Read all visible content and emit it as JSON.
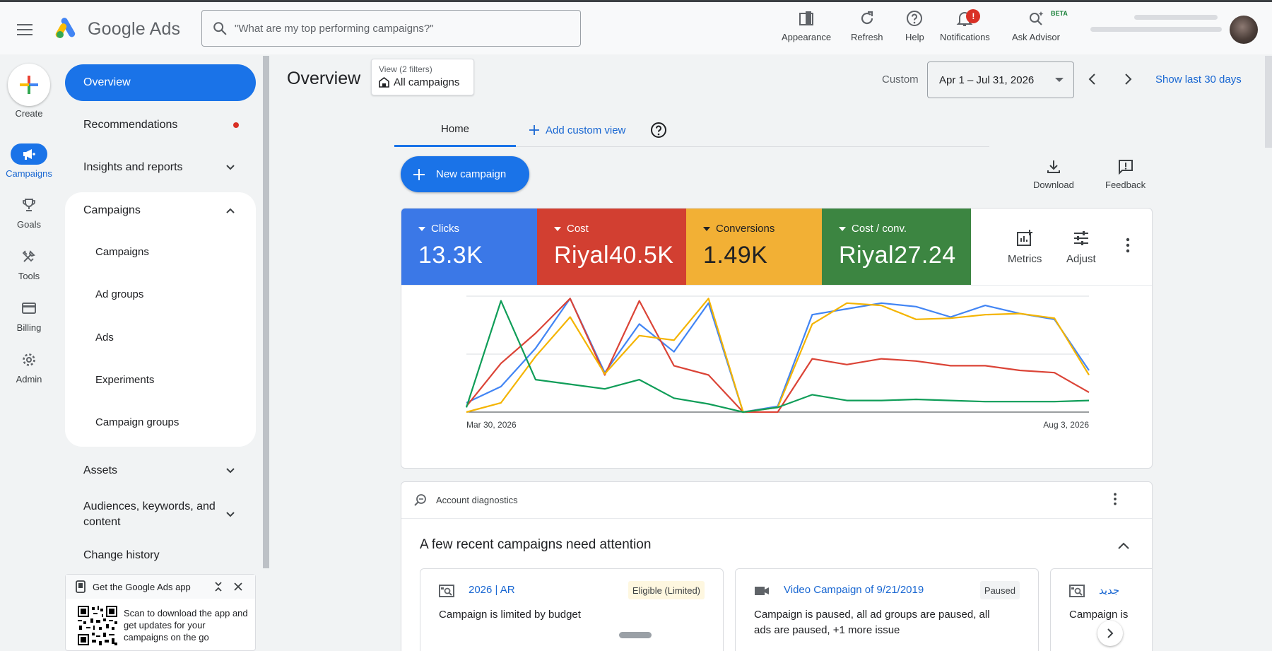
{
  "header": {
    "brand": "Google Ads",
    "search_placeholder": "\"What are my top performing campaigns?\"",
    "tools": [
      {
        "label": "Appearance",
        "icon": "appearance-icon"
      },
      {
        "label": "Refresh",
        "icon": "refresh-icon"
      },
      {
        "label": "Help",
        "icon": "help-icon"
      },
      {
        "label": "Notifications",
        "icon": "bell-icon",
        "badge": "!"
      },
      {
        "label": "Ask Advisor",
        "icon": "sparkle-search-icon",
        "tag": "BETA"
      }
    ]
  },
  "rail": {
    "create": "Create",
    "items": [
      {
        "label": "Campaigns",
        "icon": "megaphone-icon",
        "active": true
      },
      {
        "label": "Goals",
        "icon": "trophy-icon"
      },
      {
        "label": "Tools",
        "icon": "tools-icon"
      },
      {
        "label": "Billing",
        "icon": "credit-card-icon"
      },
      {
        "label": "Admin",
        "icon": "gear-icon"
      }
    ]
  },
  "nav": {
    "overview": "Overview",
    "recommendations": "Recommendations",
    "insights": "Insights and reports",
    "campaigns_group": "Campaigns",
    "sub": [
      "Campaigns",
      "Ad groups",
      "Ads",
      "Experiments",
      "Campaign groups"
    ],
    "assets": "Assets",
    "audiences_line1": "Audiences, keywords, and",
    "audiences_line2": "content",
    "change_history": "Change history"
  },
  "app_promo": {
    "title": "Get the Google Ads app",
    "text": "Scan to download the app and get updates for your campaigns on the go"
  },
  "main": {
    "title": "Overview",
    "view_label": "View (2 filters)",
    "view_value": "All campaigns",
    "custom_label": "Custom",
    "date_range": "Apr 1 – Jul 31, 2026",
    "show_last": "Show last 30 days",
    "tab_home": "Home",
    "tab_add": "Add custom view",
    "new_campaign": "New campaign",
    "download": "Download",
    "feedback": "Feedback",
    "metrics_btn": "Metrics",
    "adjust_btn": "Adjust"
  },
  "colors": {
    "clicks": "#4285f4",
    "cost": "#db4437",
    "conversions": "#f4b400",
    "cost_conv": "#0f9d58"
  },
  "metrics": [
    {
      "label": "Clicks",
      "value": "13.3K",
      "color": "#3b78e7"
    },
    {
      "label": "Cost",
      "value": "Riyal40.5K",
      "color": "#d23f31"
    },
    {
      "label": "Conversions",
      "value": "1.49K",
      "color": "#f2b035"
    },
    {
      "label": "Cost / conv.",
      "value": "Riyal27.24",
      "color": "#3c8541"
    }
  ],
  "chart_data": {
    "type": "line",
    "x_start_label": "Mar 30, 2026",
    "x_end_label": "Aug 3, 2026",
    "x": [
      "2026-03-30",
      "2026-04-06",
      "2026-04-13",
      "2026-04-20",
      "2026-04-27",
      "2026-05-04",
      "2026-05-11",
      "2026-05-18",
      "2026-05-25",
      "2026-06-01",
      "2026-06-08",
      "2026-06-15",
      "2026-06-22",
      "2026-06-29",
      "2026-07-06",
      "2026-07-13",
      "2026-07-20",
      "2026-07-27",
      "2026-08-03"
    ],
    "ylim": [
      0,
      1
    ],
    "grid": true,
    "series": [
      {
        "color": "#4285f4",
        "values": [
          0.08,
          0.22,
          0.55,
          0.98,
          0.34,
          0.76,
          0.52,
          0.94,
          0.0,
          0.05,
          0.84,
          0.89,
          0.94,
          0.91,
          0.82,
          0.92,
          0.85,
          0.8,
          0.36
        ]
      },
      {
        "color": "#db4437",
        "values": [
          0.05,
          0.42,
          0.68,
          0.98,
          0.32,
          0.96,
          0.4,
          0.32,
          0.0,
          0.0,
          0.46,
          0.41,
          0.46,
          0.44,
          0.4,
          0.4,
          0.36,
          0.34,
          0.17
        ]
      },
      {
        "color": "#f4b400",
        "values": [
          0.0,
          0.08,
          0.48,
          0.82,
          0.33,
          0.66,
          0.62,
          0.98,
          0.0,
          0.04,
          0.76,
          0.94,
          0.92,
          0.8,
          0.81,
          0.84,
          0.85,
          0.81,
          0.32
        ]
      },
      {
        "color": "#0f9d58",
        "values": [
          0.04,
          0.96,
          0.28,
          0.24,
          0.2,
          0.28,
          0.12,
          0.07,
          0.0,
          0.04,
          0.15,
          0.1,
          0.1,
          0.11,
          0.1,
          0.09,
          0.09,
          0.09,
          0.1
        ]
      }
    ]
  },
  "diagnostics": {
    "header": "Account diagnostics",
    "title": "A few recent campaigns need attention",
    "cards": [
      {
        "name": "2026 | AR",
        "badge": "Eligible (Limited)",
        "desc1": "Campaign is limited by budget",
        "desc2": ""
      },
      {
        "name": "Video Campaign of 9/21/2019",
        "badge": "Paused",
        "desc1": "Campaign is paused, all ad groups are paused, all",
        "desc2": "ads are paused, +1 more issue"
      },
      {
        "name": "جديد",
        "badge": "",
        "desc1": "Campaign is",
        "desc2": ""
      }
    ]
  }
}
